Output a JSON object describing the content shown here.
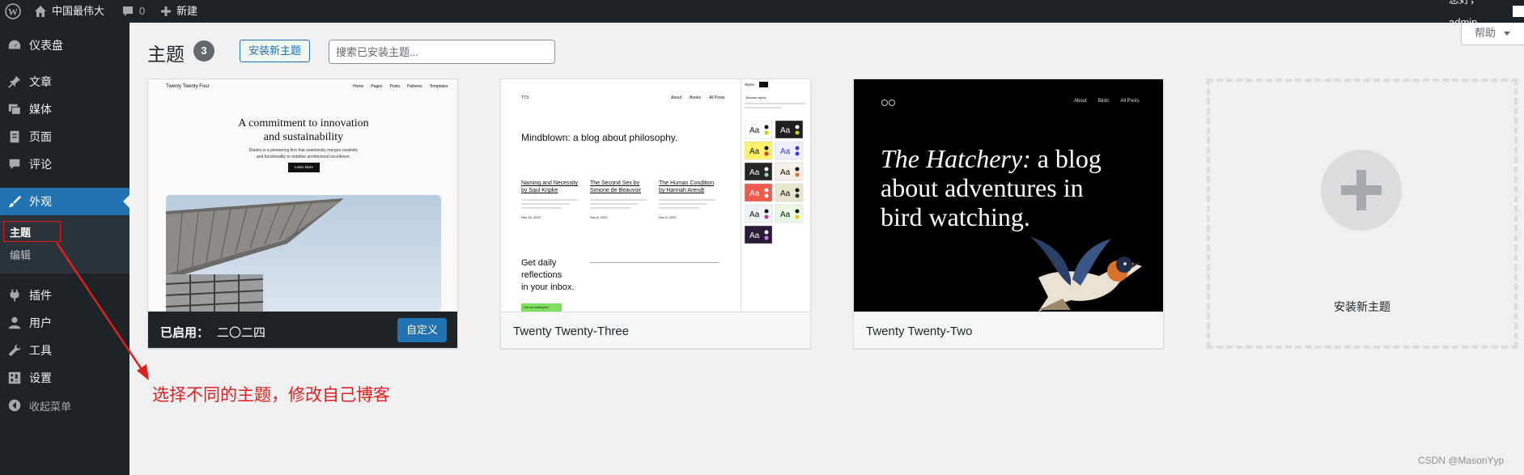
{
  "adminbar": {
    "site_name": "中国最伟大",
    "comments_count": "0",
    "new_label": "新建",
    "greeting": "您好，admin"
  },
  "sidebar": {
    "items": [
      {
        "label": "仪表盘",
        "icon": "dashboard-icon"
      },
      {
        "label": "文章",
        "icon": "pin-icon"
      },
      {
        "label": "媒体",
        "icon": "media-icon"
      },
      {
        "label": "页面",
        "icon": "page-icon"
      },
      {
        "label": "评论",
        "icon": "comment-icon"
      },
      {
        "label": "外观",
        "icon": "brush-icon"
      },
      {
        "label": "插件",
        "icon": "plugin-icon"
      },
      {
        "label": "用户",
        "icon": "user-icon"
      },
      {
        "label": "工具",
        "icon": "wrench-icon"
      },
      {
        "label": "设置",
        "icon": "settings-icon"
      }
    ],
    "submenu": [
      "主题",
      "编辑"
    ],
    "collapse_label": "收起菜单"
  },
  "header": {
    "title": "主题",
    "count": "3",
    "add_new": "安装新主题",
    "search_placeholder": "搜索已安装主题...",
    "help": "帮助"
  },
  "themes": [
    {
      "active_prefix": "已启用：",
      "name": "二〇二四",
      "customize": "自定义",
      "shot": {
        "site": "Twenty Twenty Four",
        "nav": [
          "Home",
          "Pages",
          "Posts",
          "Patterns",
          "Templates"
        ],
        "headline1": "A commitment to innovation",
        "headline2": "and sustainability",
        "sub1": "Études is a pioneering firm that seamlessly merges creativity",
        "sub2": "and functionality to redefine architectural excellence.",
        "button": "Learn More"
      }
    },
    {
      "name": "Twenty Twenty-Three",
      "shot": {
        "site": "TT3",
        "nav": [
          "About",
          "Books",
          "All Posts"
        ],
        "headline": "Mindblown: a blog about philosophy.",
        "posts": [
          {
            "title1": "Naming and Necessity",
            "title2": "by Saul Kripke",
            "date": "Nov 16, 2022"
          },
          {
            "title1": "The Second Sex by",
            "title2": "Simone de Beauvoir",
            "date": "Nov 8, 2022"
          },
          {
            "title1": "The Human Condition",
            "title2": "by Hannah Arendt",
            "date": "Nov 8, 2022"
          }
        ],
        "newsletter1": "Get daily",
        "newsletter2": "reflections",
        "newsletter3": "in your inbox.",
        "newsletter_btn": "Join our mailing list",
        "styles_title": "Styles",
        "browse": "Browse styles",
        "swatch_text": "Aa"
      }
    },
    {
      "name": "Twenty Twenty-Two",
      "shot": {
        "nav": [
          "About",
          "Birds",
          "All Posts"
        ],
        "headline_italic": "The Hatchery:",
        "headline_rest1": " a blog",
        "headline_rest2": "about adventures in",
        "headline_rest3": "bird watching."
      }
    }
  ],
  "add_theme_label": "安装新主题",
  "annotation": "选择不同的主题，修改自己博客",
  "watermark": "CSDN @MasonYyp",
  "colors": {
    "adminbar_bg": "#1d2327",
    "accent": "#2271b1",
    "annotation": "#e02020"
  }
}
